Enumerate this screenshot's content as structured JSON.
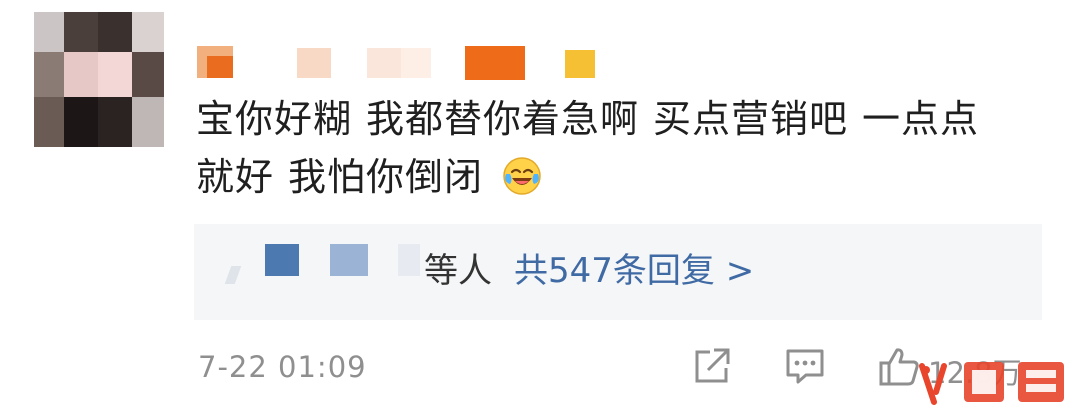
{
  "comment": {
    "text_line1_parts": [
      "宝你好糊",
      "我都替你着急啊",
      "买点营销吧",
      "一点点"
    ],
    "text_line2_parts": [
      "就好",
      "我怕你倒闭"
    ],
    "emoji": "laughing-crying-emoji"
  },
  "replies": {
    "etc_label": "等人",
    "count_label": "共547条回复 >"
  },
  "meta": {
    "timestamp": "7-22 01:09",
    "like_count": "12.8万"
  },
  "colors": {
    "link_blue": "#3f6aa3",
    "reply_bg": "#f5f6f8",
    "meta_gray": "#8f8f8f"
  }
}
